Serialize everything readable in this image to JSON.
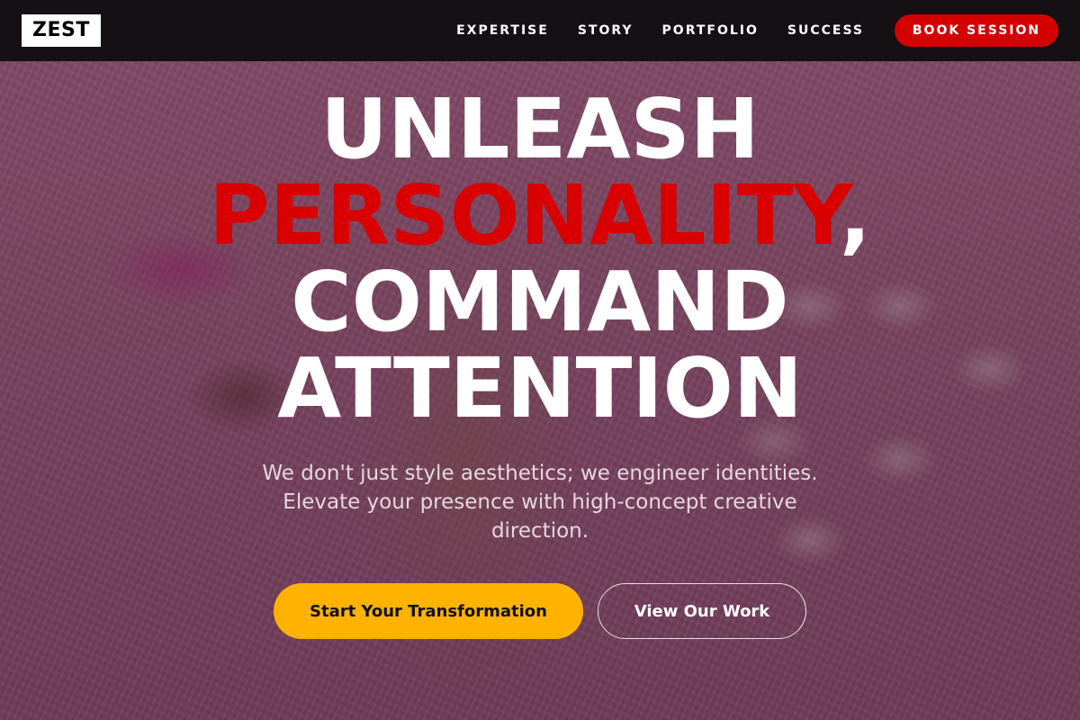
{
  "nav": {
    "logo": "ZEST",
    "links": [
      "EXPERTISE",
      "STORY",
      "PORTFOLIO",
      "SUCCESS"
    ],
    "cta_label": "BOOK SESSION"
  },
  "hero": {
    "headline_line1": "UNLEASH",
    "headline_accent": "PERSONALITY",
    "headline_comma": ",",
    "headline_line3": "COMMAND",
    "headline_line4": "ATTENTION",
    "subtext": "We don't just style aesthetics; we engineer identities. Elevate your presence with high-concept creative direction.",
    "primary_cta": "Start Your Transformation",
    "secondary_cta": "View Our Work"
  },
  "colors": {
    "accent_red": "#d90000",
    "button_red": "#d40000",
    "primary_yellow": "#ffb300",
    "navbar_bg": "#141014"
  }
}
